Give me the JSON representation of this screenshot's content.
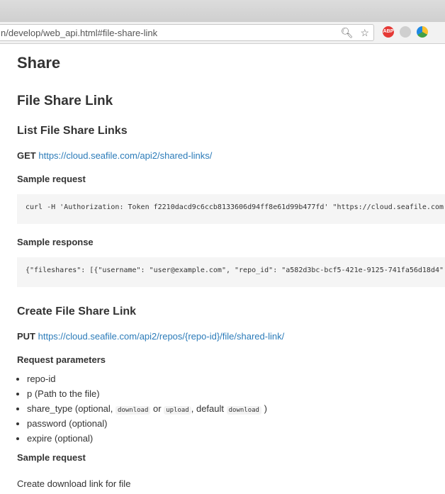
{
  "browser": {
    "url": "n/develop/web_api.html#file-share-link",
    "icons": [
      "magnifier-icon",
      "star-icon"
    ],
    "extensions": [
      {
        "name": "abp",
        "label": "ABP",
        "color": "#e53935"
      },
      {
        "name": "ext2",
        "label": "",
        "color": "#bdbdbd"
      },
      {
        "name": "ext3",
        "label": "",
        "color": "#43a047"
      }
    ]
  },
  "page": {
    "h1": "Share",
    "h2": "File Share Link",
    "sections": {
      "list": {
        "title": "List File Share Links",
        "method": "GET",
        "endpoint": "https://cloud.seafile.com/api2/shared-links/",
        "req_label": "Sample request",
        "req_code": "curl -H 'Authorization: Token f2210dacd9c6ccb8133606d94ff8e61d99b477fd' \"https://cloud.seafile.com",
        "resp_label": "Sample response",
        "resp_code": "{\"fileshares\": [{\"username\": \"user@example.com\", \"repo_id\": \"a582d3bc-bcf5-421e-9125-741fa56d18d4\""
      },
      "create": {
        "title": "Create File Share Link",
        "method": "PUT",
        "endpoint": "https://cloud.seafile.com/api2/repos/{repo-id}/file/shared-link/",
        "params_label": "Request parameters",
        "params": {
          "p1": "repo-id",
          "p2": "p (Path to the file)",
          "p3_prefix": "share_type (optional,",
          "p3_code1": "download",
          "p3_or": "or",
          "p3_code2": "upload",
          "p3_mid": ", default",
          "p3_code3": "download",
          "p3_suffix": ")",
          "p4": "password (optional)",
          "p5": "expire (optional)"
        },
        "req_label": "Sample request",
        "req_desc": "Create download link for file"
      }
    }
  }
}
